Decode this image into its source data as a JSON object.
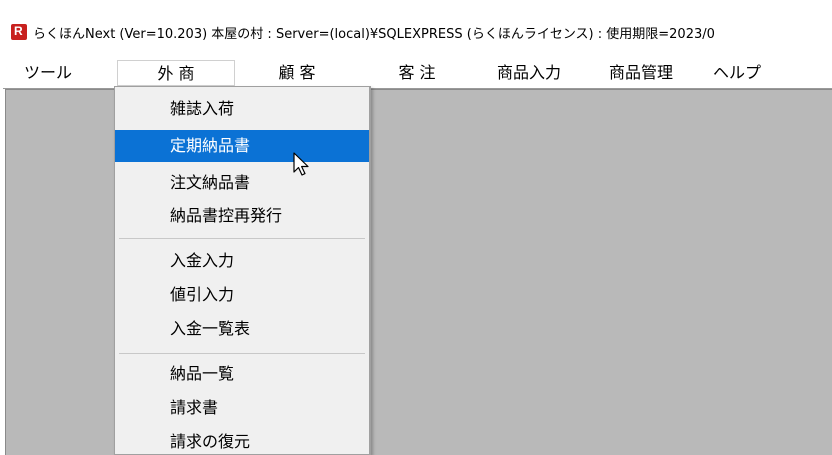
{
  "window": {
    "title": "らくほんNext (Ver=10.203) 本屋の村 : Server=(local)¥SQLEXPRESS (らくほんライセンス) : 使用期限=2023/0"
  },
  "menubar": {
    "items": [
      {
        "label": "ツール"
      },
      {
        "label": "外 商"
      },
      {
        "label": "顧 客"
      },
      {
        "label": "客 注"
      },
      {
        "label": "商品入力"
      },
      {
        "label": "商品管理"
      },
      {
        "label": "ヘルプ"
      }
    ]
  },
  "dropdown": {
    "items": [
      {
        "label": "雑誌入荷"
      },
      {
        "label": "定期納品書"
      },
      {
        "label": "注文納品書"
      },
      {
        "label": "納品書控再発行"
      },
      {
        "label": "入金入力"
      },
      {
        "label": "値引入力"
      },
      {
        "label": "入金一覧表"
      },
      {
        "label": "納品一覧"
      },
      {
        "label": "請求書"
      },
      {
        "label": "請求の復元"
      }
    ],
    "highlighted_index": 1
  },
  "colors": {
    "highlight": "#0b72d5",
    "client_area": "#b9b9b9",
    "menu_bg": "#f0f0f0"
  }
}
